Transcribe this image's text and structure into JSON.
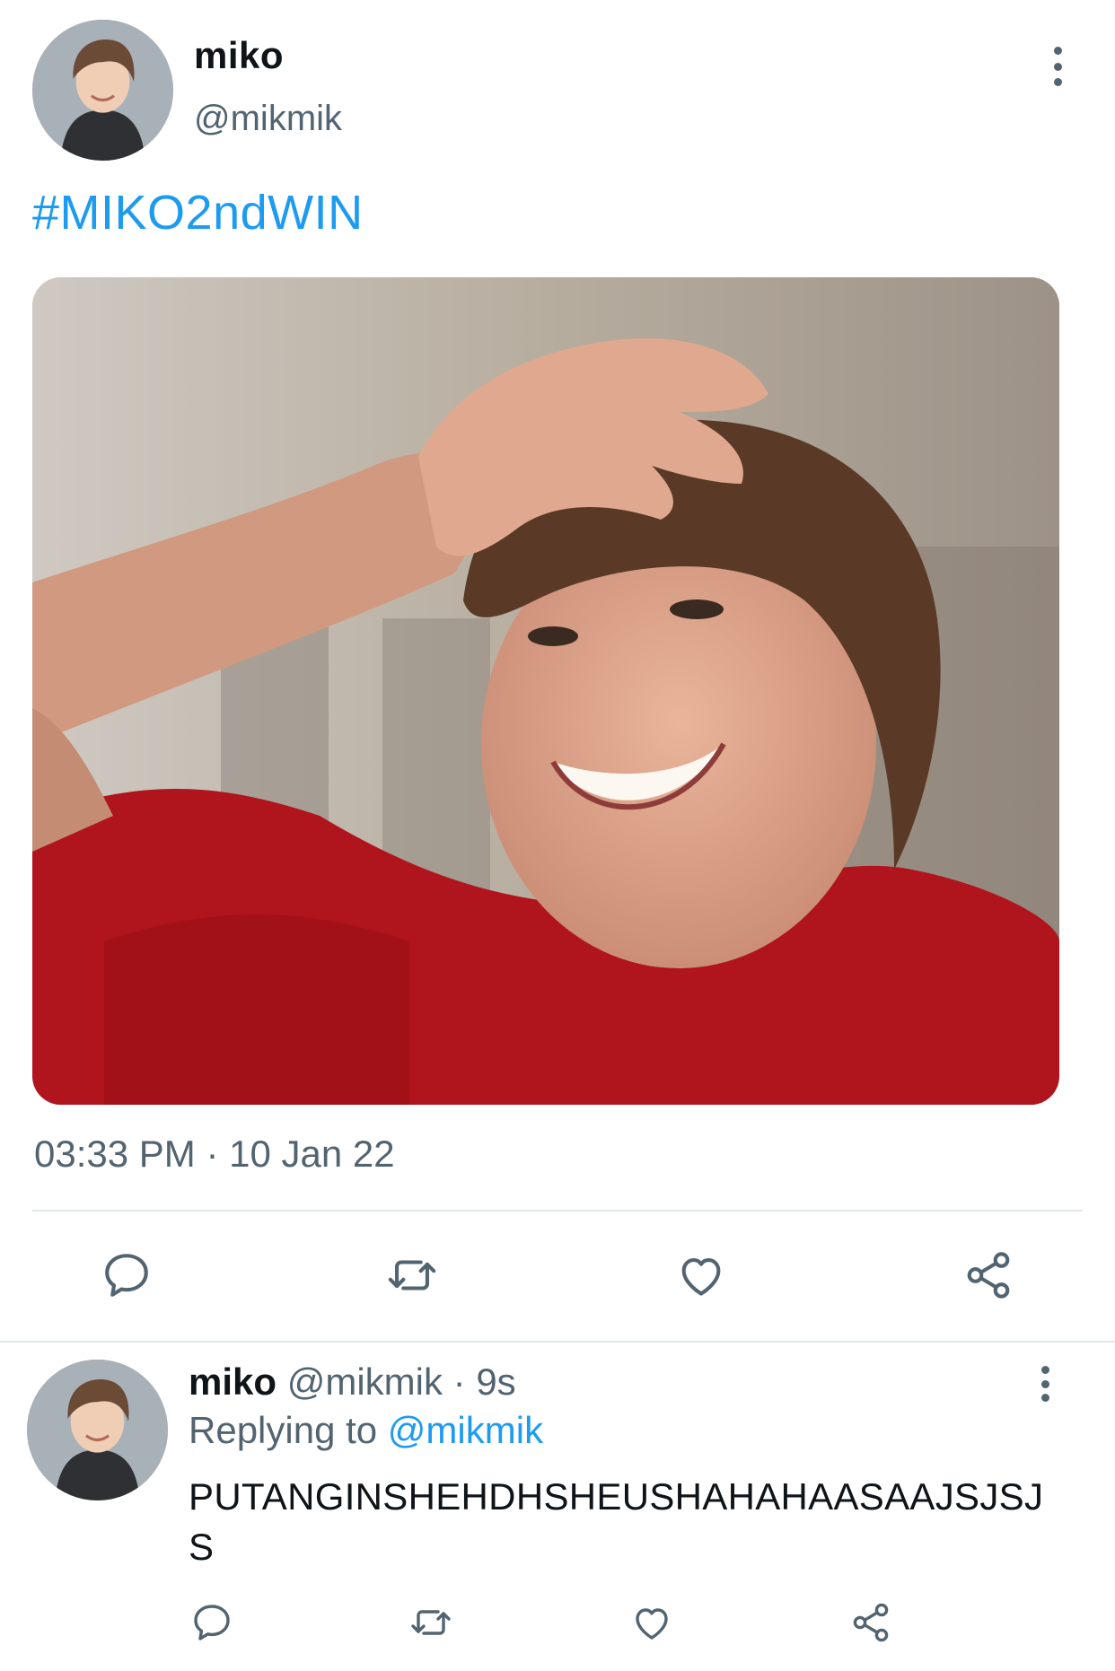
{
  "main_tweet": {
    "name": "miko",
    "handle": "@mikmik",
    "hashtag": "#MIKO2ndWIN",
    "timestamp": "03:33 PM · 10 Jan 22",
    "more_icon": "more-vertical-icon",
    "actions": [
      "reply-icon",
      "retweet-icon",
      "like-icon",
      "share-icon"
    ]
  },
  "reply_tweet": {
    "name": "miko",
    "handle": "@mikmik",
    "separator": "·",
    "time": "9s",
    "replying_prefix": "Replying to",
    "replying_to": "@mikmik",
    "text": "PUTANGINSHEHDHSHEUSHAHAHAASAAJSJSJS",
    "more_icon": "more-vertical-icon",
    "actions": [
      "reply-icon",
      "retweet-icon",
      "like-icon",
      "share-icon"
    ]
  },
  "colors": {
    "link": "#1d9bf0",
    "secondary_text": "#536471",
    "primary_text": "#0f1419",
    "divider": "#e1e8ed"
  }
}
